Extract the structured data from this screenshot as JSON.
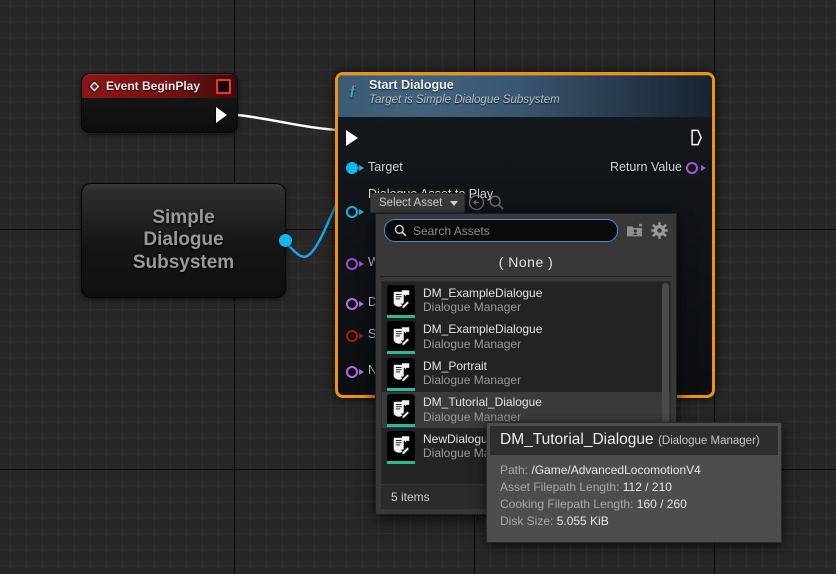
{
  "graph": {
    "event_node": {
      "title": "Event BeginPlay",
      "icon": "event-diamond-icon",
      "delegate_icon": "delegate-pin-icon"
    },
    "subsystem_node": {
      "label": "Simple\nDialogue\nSubsystem",
      "line1": "Simple",
      "line2": "Dialogue",
      "line3": "Subsystem"
    },
    "start_dialogue_node": {
      "title": "Start Dialogue",
      "subtitle": "Target is Simple Dialogue Subsystem",
      "function_icon": "function-f-icon",
      "selection_color": "#f0920e",
      "pins": {
        "target": "Target",
        "return_value": "Return Value",
        "dialogue_asset_to_play": "Dialogue Asset to Play",
        "hidden_1": "W",
        "hidden_2": "D",
        "hidden_3": "S",
        "hidden_4": "N"
      },
      "asset_combo": {
        "label": "Select Asset",
        "chevron_icon": "chevron-down-icon",
        "use_selected_icon": "use-selected-asset-icon",
        "browse_icon": "browse-to-asset-icon"
      }
    }
  },
  "asset_picker": {
    "search": {
      "placeholder": "Search Assets",
      "icon": "search-icon"
    },
    "view_options_icon": "view-options-icon",
    "settings_icon": "gear-icon",
    "none_option": "( None )",
    "items": [
      {
        "name": "DM_ExampleDialogue",
        "type": "Dialogue Manager",
        "icon": "dialogue-asset-icon"
      },
      {
        "name": "DM_ExampleDialogue",
        "type": "Dialogue Manager",
        "icon": "dialogue-asset-icon"
      },
      {
        "name": "DM_Portrait",
        "type": "Dialogue Manager",
        "icon": "dialogue-asset-icon"
      },
      {
        "name": "DM_Tutorial_Dialogue",
        "type": "Dialogue Manager",
        "icon": "dialogue-asset-icon"
      },
      {
        "name": "NewDialogue",
        "type": "Dialogue Manager",
        "icon": "dialogue-asset-icon"
      }
    ],
    "footer": "5 items"
  },
  "tooltip": {
    "title": "DM_Tutorial_Dialogue",
    "class": "(Dialogue Manager)",
    "rows": [
      {
        "key": "Path:",
        "value": "/Game/AdvancedLocomotionV4"
      },
      {
        "key": "Asset Filepath Length:",
        "value": "112 / 210"
      },
      {
        "key": "Cooking Filepath Length:",
        "value": "160 / 260"
      },
      {
        "key": "Disk Size:",
        "value": "5.055 KiB"
      }
    ]
  },
  "colors": {
    "exec_pin": "#ffffff",
    "object_pin": "#12b6f0",
    "struct_pin": "#1b73c4",
    "selection": "#f0920e",
    "asset_bar": "#27bb9c"
  }
}
